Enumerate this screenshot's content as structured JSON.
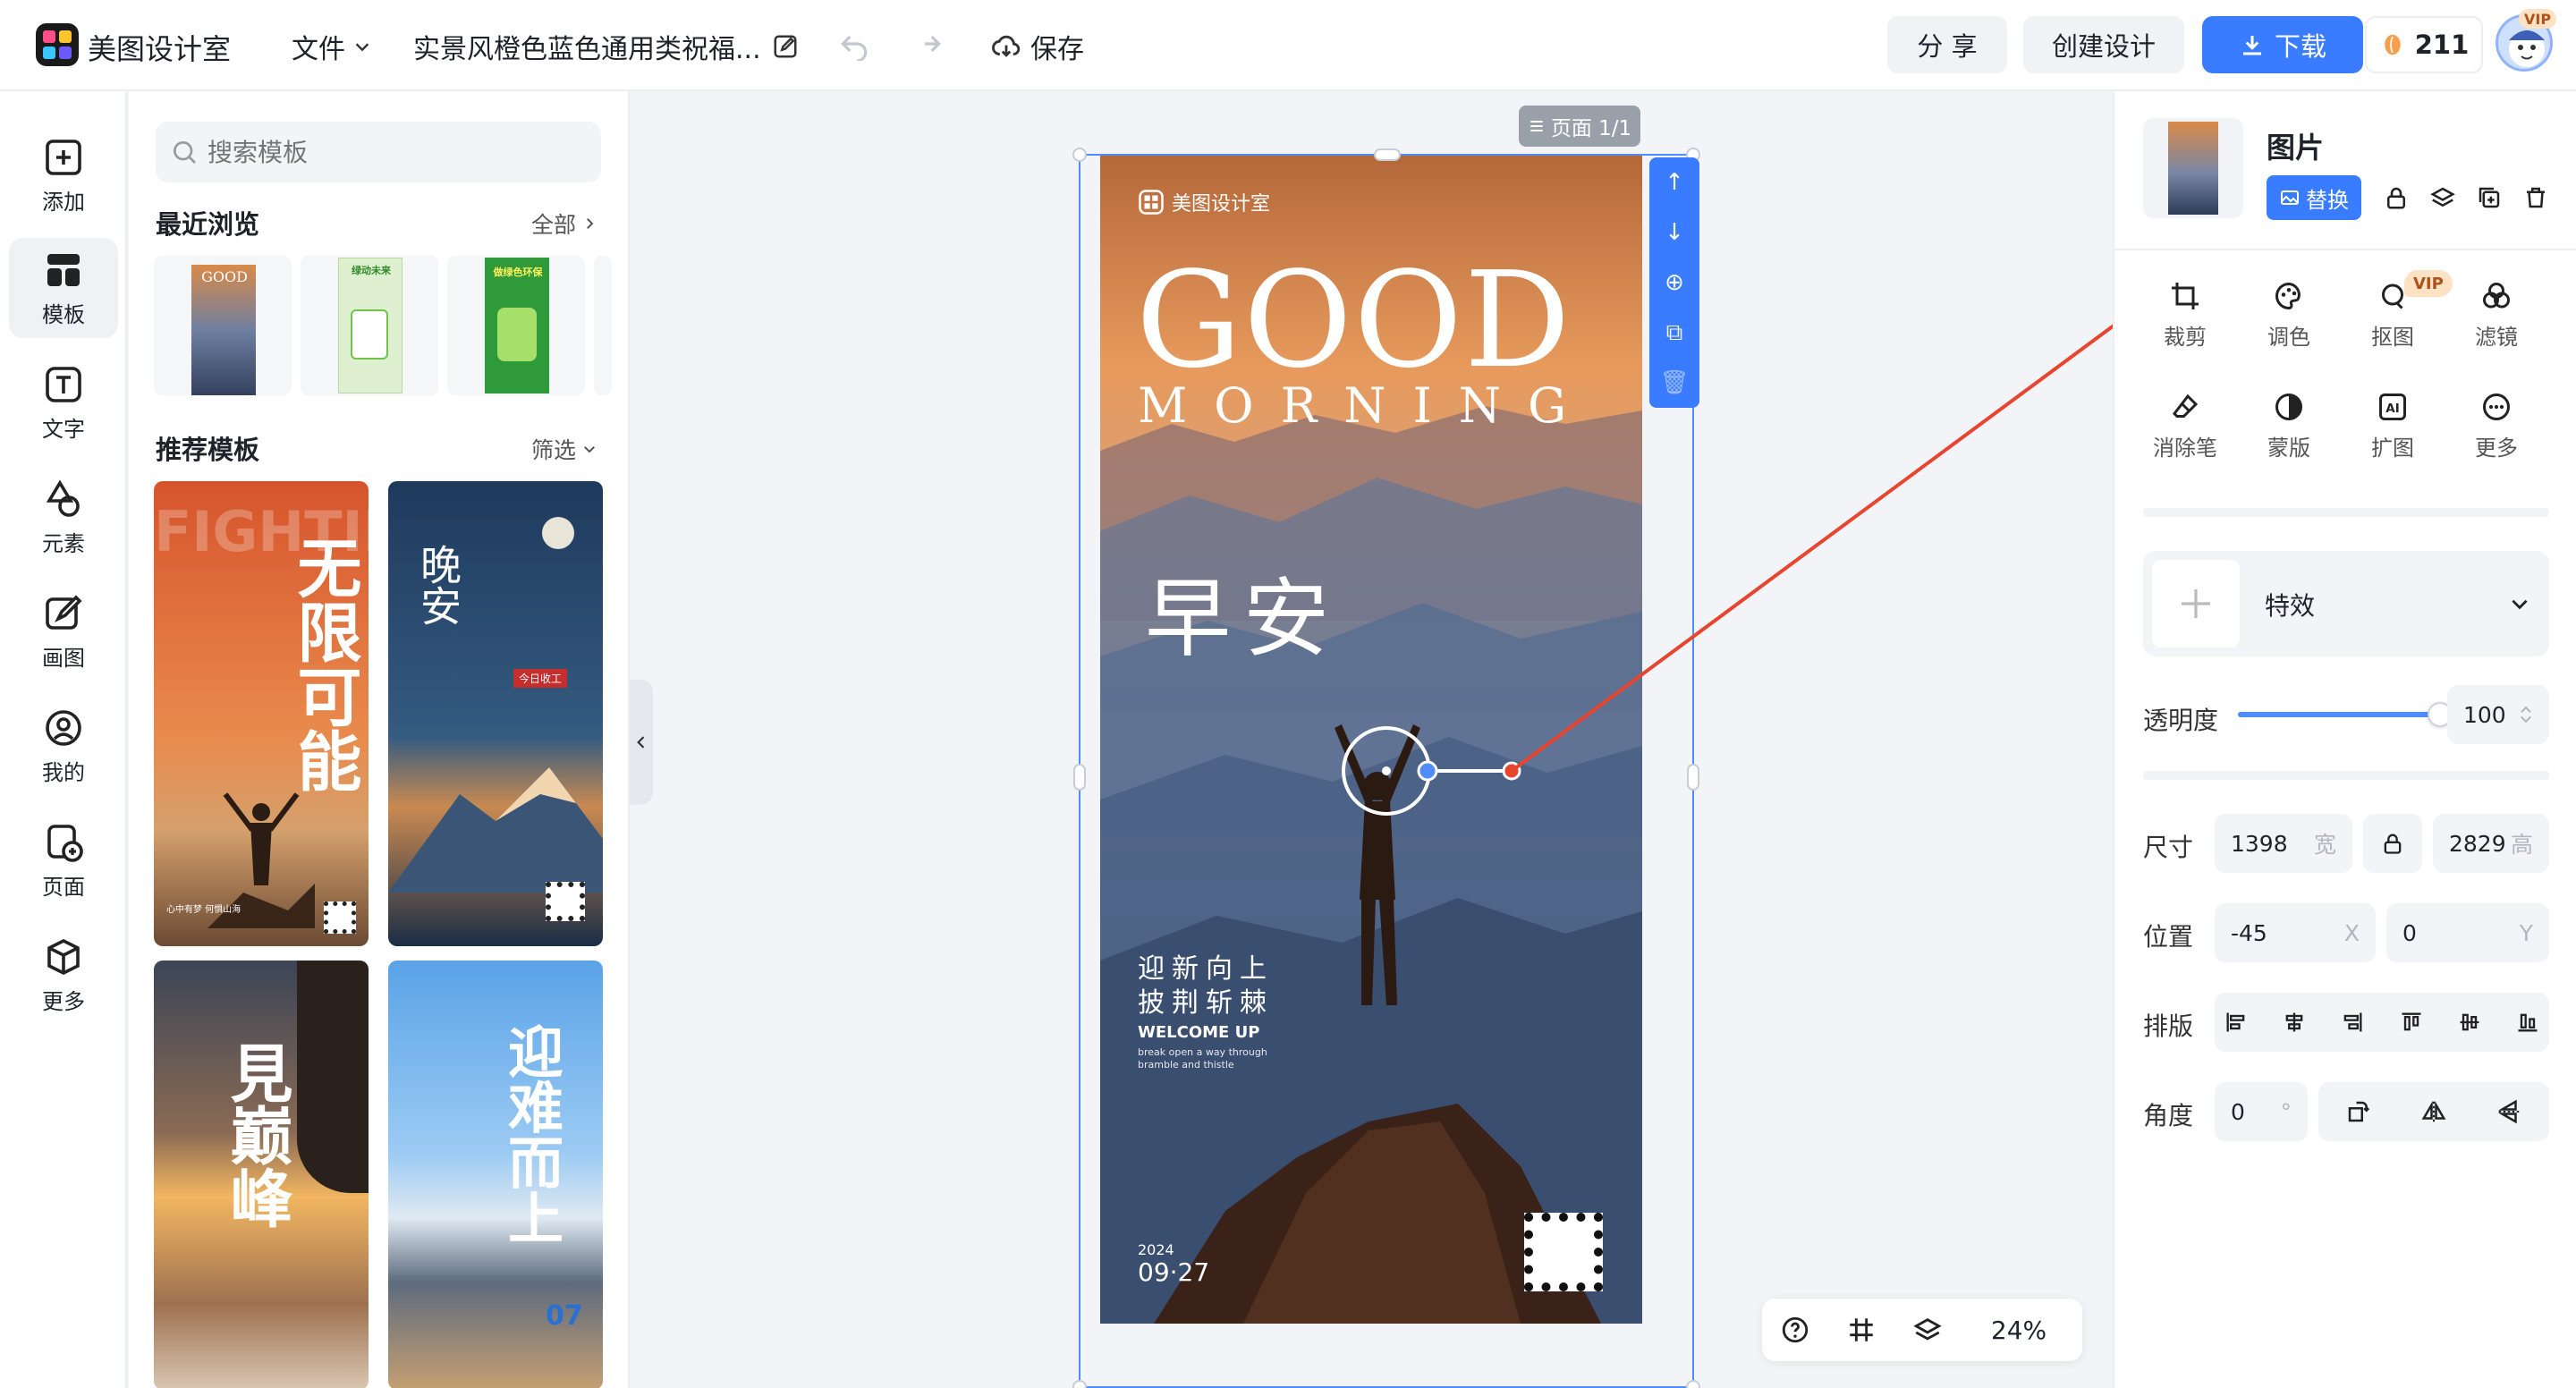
{
  "topbar": {
    "app_name": "美图设计室",
    "file_menu": "文件",
    "doc_title": "实景风橙色蓝色通用类祝福...",
    "save_label": "保存",
    "share_label": "分 享",
    "create_label": "创建设计",
    "download_label": "下载",
    "points": "211",
    "vip_badge": "VIP"
  },
  "rail": {
    "items": [
      {
        "label": "添加",
        "icon": "plus-square-icon"
      },
      {
        "label": "模板",
        "icon": "template-icon"
      },
      {
        "label": "文字",
        "icon": "text-icon"
      },
      {
        "label": "元素",
        "icon": "shapes-icon"
      },
      {
        "label": "画图",
        "icon": "paint-icon"
      },
      {
        "label": "我的",
        "icon": "user-icon"
      },
      {
        "label": "页面",
        "icon": "page-icon"
      },
      {
        "label": "更多",
        "icon": "cube-icon"
      }
    ]
  },
  "panel": {
    "search_placeholder": "搜索模板",
    "recent_title": "最近浏览",
    "recent_all": "全部",
    "recommend_title": "推荐模板",
    "filter_label": "筛选",
    "templates": [
      {
        "title": "无限可能",
        "bg": "FIGHTING",
        "sub": "心中有梦 何惧山海"
      },
      {
        "title": "晚安",
        "tag": "今日收工"
      },
      {
        "title": "見巅峰"
      },
      {
        "title": "迎难而上",
        "num": "07"
      }
    ],
    "recent_thumbs": [
      "GOOD",
      "绿动未来",
      "做绿色环保"
    ]
  },
  "canvas": {
    "page_tag": "页面 1/1",
    "zoom": "24%",
    "poster": {
      "brand": "美图设计室",
      "good": "GOOD",
      "morning": "MORNING",
      "zaoan": "早安",
      "line1": "迎新向上",
      "line2": "披荆斩棘",
      "welcome": "WELCOME UP",
      "small1": "break open a way through",
      "small2": "bramble and thistle",
      "year": "2024",
      "date": "09·27"
    }
  },
  "props": {
    "title": "图片",
    "replace_label": "替换",
    "vip_tag": "VIP",
    "tools": [
      {
        "label": "裁剪",
        "icon": "crop-icon"
      },
      {
        "label": "调色",
        "icon": "palette-icon"
      },
      {
        "label": "抠图",
        "icon": "cutout-icon"
      },
      {
        "label": "滤镜",
        "icon": "filter-icon"
      },
      {
        "label": "消除笔",
        "icon": "eraser-icon"
      },
      {
        "label": "蒙版",
        "icon": "mask-icon"
      },
      {
        "label": "扩图",
        "icon": "expand-icon"
      },
      {
        "label": "更多",
        "icon": "more-icon"
      }
    ],
    "effects_label": "特效",
    "opacity_label": "透明度",
    "opacity_value": "100",
    "opacity_fraction": 1.0,
    "size_label": "尺寸",
    "width_value": "1398",
    "width_unit": "宽",
    "height_value": "2829",
    "height_unit": "高",
    "position_label": "位置",
    "x_value": "-45",
    "x_unit": "X",
    "y_value": "0",
    "y_unit": "Y",
    "layout_label": "排版",
    "angle_label": "角度",
    "angle_value": "0",
    "angle_unit": "°"
  },
  "colors": {
    "accent": "#3a7cff",
    "arrow": "#e8442e"
  }
}
